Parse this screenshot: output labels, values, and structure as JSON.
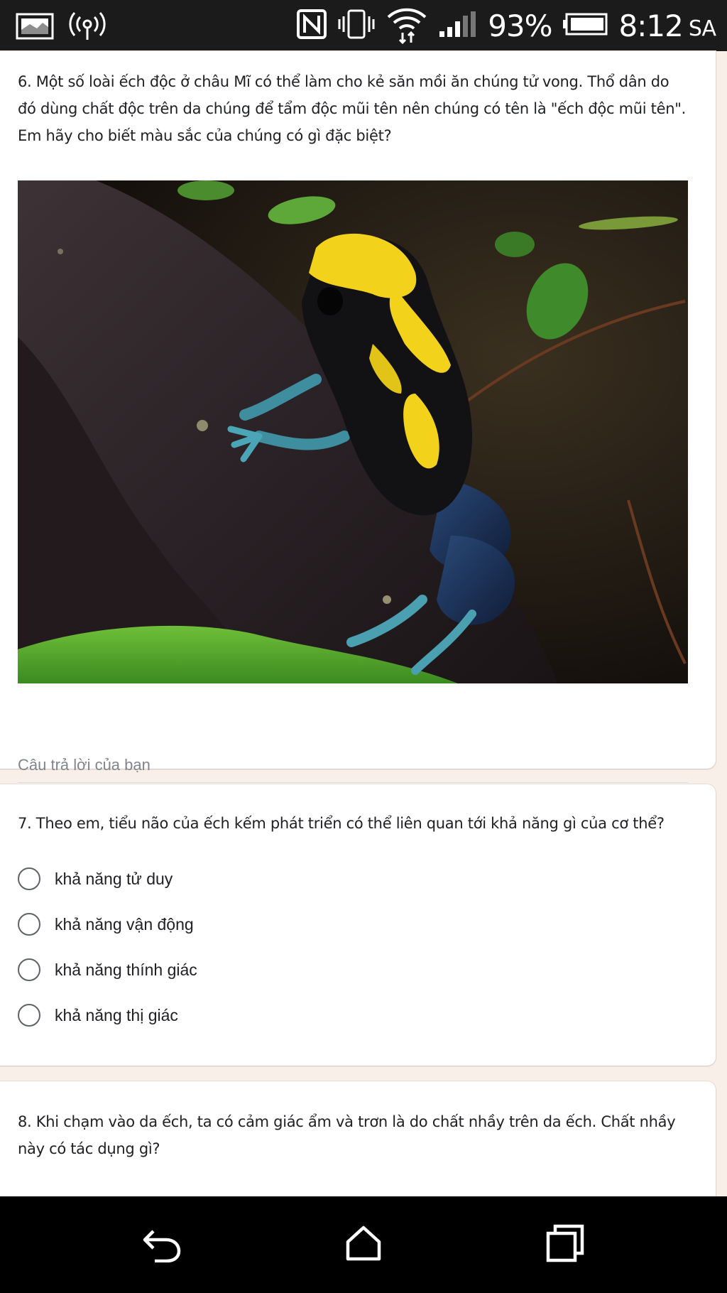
{
  "status_bar": {
    "battery_percent": "93%",
    "time": "8:12",
    "am_pm": "SA",
    "icons": [
      "gallery-notification-icon",
      "hotspot-icon",
      "nfc-icon",
      "vibrate-icon",
      "wifi-icon",
      "signal-icon",
      "battery-icon"
    ]
  },
  "form": {
    "q6": {
      "text": "6. Một số loài ếch độc ở châu Mĩ có thể làm cho kẻ săn mồi ăn chúng tử vong. Thổ dân do đó dùng chất độc trên da chúng để tẩm độc mũi tên nên chúng có tên là \"ếch độc mũi tên\". Em hãy cho biết màu sắc của chúng có gì đặc biệt?",
      "answer_placeholder": "Câu trả lời của bạn"
    },
    "q7": {
      "text": "7. Theo em, tiểu não của ếch kếm phát triển có thể liên quan tới khả năng gì của cơ thể?",
      "options": [
        "khả năng tử duy",
        "khả năng vận động",
        "khả năng thính giác",
        "khả năng thị giác"
      ]
    },
    "q8": {
      "text": "8. Khi chạm vào da ếch, ta có cảm giác ẩm và trơn là do chất nhầy trên da ếch. Chất nhầy này có tác dụng gì?"
    }
  },
  "nav_bar": {
    "icons": [
      "back-icon",
      "home-icon",
      "recents-icon"
    ]
  }
}
